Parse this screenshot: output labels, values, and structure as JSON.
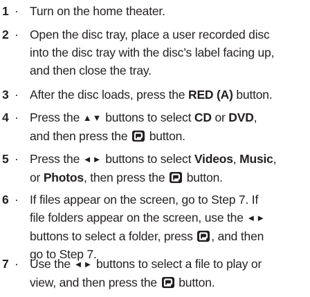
{
  "steps": [
    {
      "number": "1",
      "dot": "·",
      "lines": [
        [
          {
            "t": "Turn on the home theater."
          }
        ]
      ]
    },
    {
      "number": "2",
      "dot": "·",
      "lines": [
        [
          {
            "t": "Open the disc tray, place a user recorded disc"
          }
        ],
        [
          {
            "t": "into the disc tray with the disc’s label facing up,"
          }
        ],
        [
          {
            "t": "and then close the tray."
          }
        ]
      ]
    },
    {
      "number": "3",
      "dot": "·",
      "lines": [
        [
          {
            "t": "After the disc loads,  press the "
          },
          {
            "t": "RED (A)",
            "b": true
          },
          {
            "t": " button."
          }
        ]
      ]
    },
    {
      "number": "4",
      "dot": "·",
      "lines": [
        [
          {
            "t": "Press the "
          },
          {
            "arrow": "▲▼"
          },
          {
            "t": " buttons to select "
          },
          {
            "t": "CD",
            "b": true
          },
          {
            "t": " or "
          },
          {
            "t": "DVD",
            "b": true
          },
          {
            "t": ","
          }
        ],
        [
          {
            "t": "and then press the "
          },
          {
            "icon": "enter"
          },
          {
            "t": " button."
          }
        ]
      ]
    },
    {
      "number": "5",
      "dot": "·",
      "lines": [
        [
          {
            "t": "Press the "
          },
          {
            "arrow": "◄►"
          },
          {
            "t": " buttons to select "
          },
          {
            "t": "Videos",
            "b": true
          },
          {
            "t": ", "
          },
          {
            "t": "Music",
            "b": true
          },
          {
            "t": ","
          }
        ],
        [
          {
            "t": "or "
          },
          {
            "t": "Photos",
            "b": true
          },
          {
            "t": ", then press the "
          },
          {
            "icon": "enter"
          },
          {
            "t": " button."
          }
        ]
      ]
    },
    {
      "number": "6",
      "dot": "·",
      "lines": [
        [
          {
            "t": "If files appear on the screen, go to Step 7. If"
          }
        ],
        [
          {
            "t": "file folders appear on the screen, use the "
          },
          {
            "arrow": "◄►"
          }
        ],
        [
          {
            "t": "buttons to select a folder, press "
          },
          {
            "icon": "enter"
          },
          {
            "t": ", and then"
          }
        ],
        [
          {
            "t": "go to Step 7."
          }
        ]
      ]
    },
    {
      "number": "7",
      "dot": "·",
      "lines": [
        [
          {
            "t": "Use the "
          },
          {
            "arrow": "◄►"
          },
          {
            "t": " buttons to select a file to play or"
          }
        ],
        [
          {
            "t": "view, and then press the "
          },
          {
            "icon": "enter"
          },
          {
            "t": " button."
          }
        ]
      ]
    }
  ]
}
